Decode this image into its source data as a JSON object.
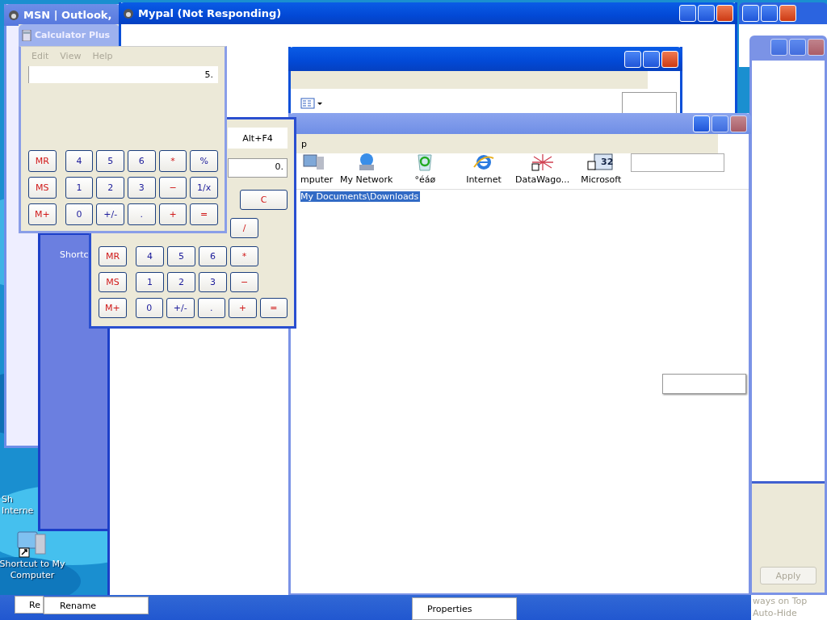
{
  "desktop": {
    "icons": [
      {
        "label_lines": [
          "Sh",
          "Interne"
        ],
        "kind": "partial"
      },
      {
        "label_lines": [
          "Shortcut to My",
          "Computer"
        ],
        "kind": "computer"
      }
    ]
  },
  "left_window": {
    "label": "Shortc"
  },
  "msn_window": {
    "title": "MSN | Outlook,"
  },
  "calculator_plus_window": {
    "title": "Calculator Plus"
  },
  "mypal_window": {
    "title": "Mypal (Not Responding)"
  },
  "explorer_window": {
    "menu_fragment": "p",
    "icons": [
      {
        "label": "mputer",
        "kind": "computer"
      },
      {
        "label": "My Network",
        "kind": "network"
      },
      {
        "label": "°éáø",
        "kind": "recycle"
      },
      {
        "label": "Internet",
        "kind": "browser"
      },
      {
        "label": "DataWago...",
        "kind": "spider"
      },
      {
        "label": "Microsoft",
        "kind": "calendar",
        "badge": "32"
      }
    ],
    "address": "My Documents\\Downloads"
  },
  "back_calculator": {
    "menu_item": "Alt+F4",
    "display": "0.",
    "clear_key": "C",
    "divide_key": "/",
    "rows": [
      [
        {
          "label": "MR",
          "kind": "memory"
        },
        {
          "label": "4",
          "kind": "digit"
        },
        {
          "label": "5",
          "kind": "digit"
        },
        {
          "label": "6",
          "kind": "digit"
        },
        {
          "label": "*",
          "kind": "operator"
        }
      ],
      [
        {
          "label": "MS",
          "kind": "memory"
        },
        {
          "label": "1",
          "kind": "digit"
        },
        {
          "label": "2",
          "kind": "digit"
        },
        {
          "label": "3",
          "kind": "digit"
        },
        {
          "label": "−",
          "kind": "operator"
        }
      ],
      [
        {
          "label": "M+",
          "kind": "memory"
        },
        {
          "label": "0",
          "kind": "digit"
        },
        {
          "label": "+/-",
          "kind": "digit"
        },
        {
          "label": ".",
          "kind": "digit"
        },
        {
          "label": "+",
          "kind": "operator"
        },
        {
          "label": "=",
          "kind": "operator"
        }
      ]
    ]
  },
  "front_calculator": {
    "menu": [
      {
        "label": "Edit",
        "disabled": true
      },
      {
        "label": "View",
        "disabled": true
      },
      {
        "label": "Help",
        "disabled": true
      }
    ],
    "display": "5.",
    "rows": [
      [
        {
          "label": "MR",
          "kind": "memory"
        },
        {
          "label": "4",
          "kind": "digit"
        },
        {
          "label": "5",
          "kind": "digit"
        },
        {
          "label": "6",
          "kind": "digit"
        },
        {
          "label": "*",
          "kind": "operator"
        },
        {
          "label": "%",
          "kind": "digit"
        }
      ],
      [
        {
          "label": "MS",
          "kind": "memory"
        },
        {
          "label": "1",
          "kind": "digit"
        },
        {
          "label": "2",
          "kind": "digit"
        },
        {
          "label": "3",
          "kind": "digit"
        },
        {
          "label": "−",
          "kind": "operator"
        },
        {
          "label": "1/x",
          "kind": "digit"
        }
      ],
      [
        {
          "label": "M+",
          "kind": "memory"
        },
        {
          "label": "0",
          "kind": "digit"
        },
        {
          "label": "+/-",
          "kind": "digit"
        },
        {
          "label": ".",
          "kind": "digit"
        },
        {
          "label": "+",
          "kind": "operator"
        },
        {
          "label": "=",
          "kind": "operator"
        }
      ]
    ]
  },
  "settings_panel": {
    "apply": {
      "label": "Apply",
      "disabled": true
    }
  },
  "taskbar_menus": [
    {
      "label": "Re"
    },
    {
      "label": "Rename"
    },
    {
      "label": "Properties"
    },
    {
      "label": "ways on Top"
    },
    {
      "label": "Auto-Hide"
    }
  ]
}
